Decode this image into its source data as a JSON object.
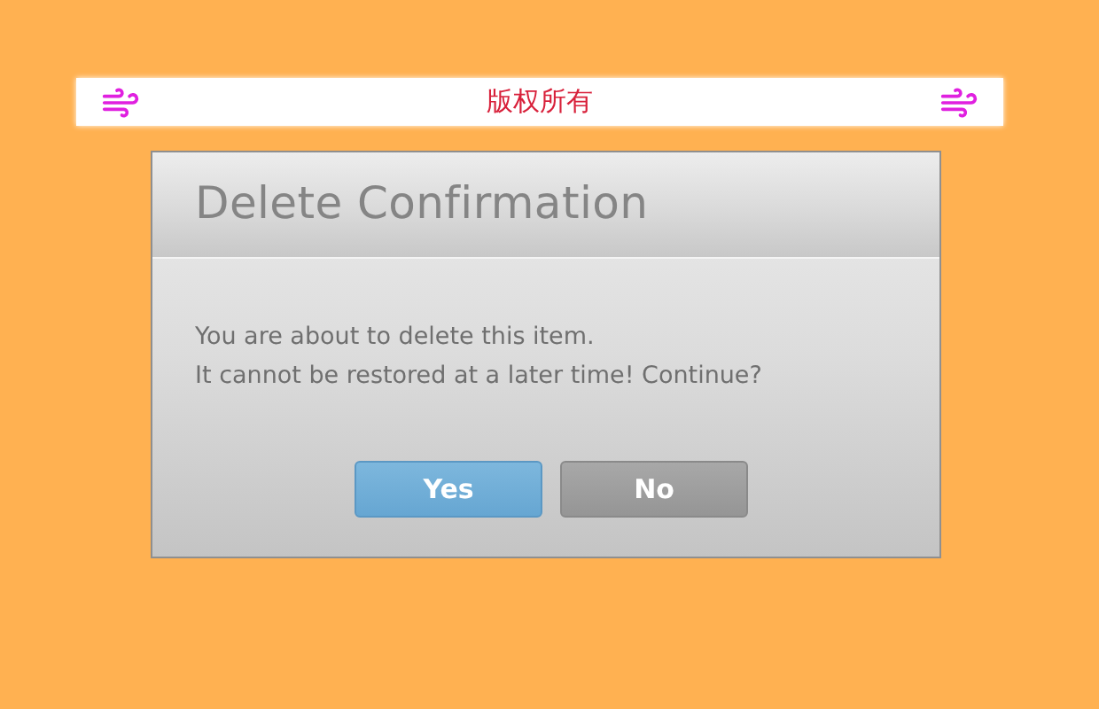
{
  "banner": {
    "text": "版权所有"
  },
  "dialog": {
    "title": "Delete Confirmation",
    "message_lines": [
      "You are about to delete this item.",
      "It cannot be restored at a later time! Continue?"
    ],
    "buttons": [
      {
        "label": "Yes",
        "kind": "primary"
      },
      {
        "label": "No",
        "kind": "secondary"
      }
    ]
  }
}
